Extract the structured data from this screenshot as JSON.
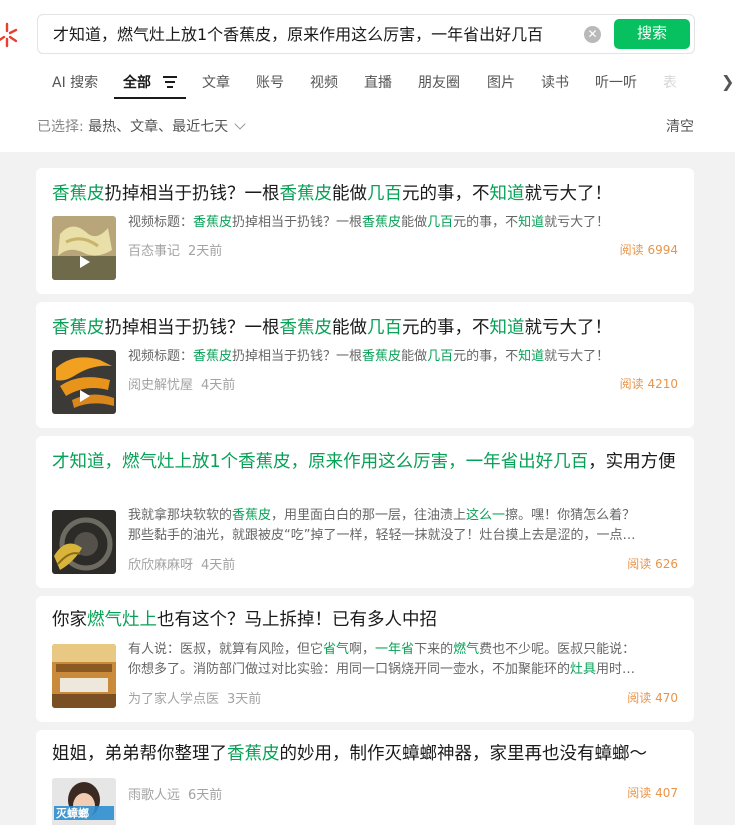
{
  "search": {
    "query": "才知道，燃气灶上放1个香蕉皮，原来作用这么厉害，一年省出好几百",
    "button_label": "搜索"
  },
  "tabs": [
    "AI 搜索",
    "全部",
    "文章",
    "账号",
    "视频",
    "直播",
    "朋友圈",
    "图片",
    "读书",
    "听一听",
    "表"
  ],
  "filters": {
    "prefix": "已选择:",
    "selected": "最热、文章、最近七天",
    "clear_label": "清空"
  },
  "results": [
    {
      "title": [
        [
          "香蕉皮",
          true
        ],
        [
          "扔掉相当于扔钱？一根",
          false
        ],
        [
          "香蕉皮",
          true
        ],
        [
          "能做",
          false
        ],
        [
          "几百",
          true
        ],
        [
          "元的事，不",
          false
        ],
        [
          "知道",
          true
        ],
        [
          "就亏大了！",
          false
        ]
      ],
      "snippet1": [
        [
          "视频标题：",
          false
        ],
        [
          "香蕉皮",
          true
        ],
        [
          "扔掉相当于扔钱？一根",
          false
        ],
        [
          "香蕉皮",
          true
        ],
        [
          "能做",
          false
        ],
        [
          "几百",
          true
        ],
        [
          "元的事，不",
          false
        ],
        [
          "知道",
          true
        ],
        [
          "就亏大了！",
          false
        ]
      ],
      "snippet2": [],
      "source": "百态事记",
      "time": "2天前",
      "reads": "阅读 6994",
      "video": true
    },
    {
      "title": [
        [
          "香蕉皮",
          true
        ],
        [
          "扔掉相当于扔钱？一根",
          false
        ],
        [
          "香蕉皮",
          true
        ],
        [
          "能做",
          false
        ],
        [
          "几百",
          true
        ],
        [
          "元的事，不",
          false
        ],
        [
          "知道",
          true
        ],
        [
          "就亏大了！",
          false
        ]
      ],
      "snippet1": [
        [
          "视频标题：",
          false
        ],
        [
          "香蕉皮",
          true
        ],
        [
          "扔掉相当于扔钱？一根",
          false
        ],
        [
          "香蕉皮",
          true
        ],
        [
          "能做",
          false
        ],
        [
          "几百",
          true
        ],
        [
          "元的事，不",
          false
        ],
        [
          "知道",
          true
        ],
        [
          "就亏大了！",
          false
        ]
      ],
      "snippet2": [],
      "source": "阅史解忧屋",
      "time": "4天前",
      "reads": "阅读 4210",
      "video": true
    },
    {
      "title": [
        [
          "才知道，燃气灶上放1个香蕉皮，原来作用这么厉害，一年省出好几百",
          true
        ],
        [
          "，实用方便",
          false
        ]
      ],
      "snippet1": [
        [
          "我就拿那块软软的",
          false
        ],
        [
          "香蕉皮",
          true
        ],
        [
          "，用里面白白的那一层，往油渍上",
          false
        ],
        [
          "这么一",
          true
        ],
        [
          "擦。嘿！你猜怎么着？",
          false
        ]
      ],
      "snippet2": [
        [
          "那些黏手的油光，就跟被皮“吃”掉了一样，轻轻一抹就没了！灶台摸上去是涩的，一点…",
          false
        ]
      ],
      "source": "欣欣麻麻呀",
      "time": "4天前",
      "reads": "阅读 626",
      "video": false
    },
    {
      "title": [
        [
          "你家",
          false
        ],
        [
          "燃气灶上",
          true
        ],
        [
          "也有这个？马上拆掉！已有多人中招",
          false
        ]
      ],
      "snippet1": [
        [
          "有人说：医叔，就算有风险，但它",
          false
        ],
        [
          "省气",
          true
        ],
        [
          "啊，",
          false
        ],
        [
          "一年省",
          true
        ],
        [
          "下来的",
          false
        ],
        [
          "燃气",
          true
        ],
        [
          "费也不少呢。医叔只能说：",
          false
        ]
      ],
      "snippet2": [
        [
          "你想多了。消防部门做过对比实验：用同一口锅烧开同一壶水，不加聚能环的",
          false
        ],
        [
          "灶具",
          true
        ],
        [
          "用时…",
          false
        ]
      ],
      "source": "为了家人学点医",
      "time": "3天前",
      "reads": "阅读 470",
      "video": false
    },
    {
      "title": [
        [
          "姐姐，弟弟帮你整理了",
          false
        ],
        [
          "香蕉皮",
          true
        ],
        [
          "的妙用，制作灭蟑螂神器，家里再也没有蟑螂～",
          false
        ]
      ],
      "snippet1": [],
      "snippet2": [],
      "source": "雨歌人远",
      "time": "6天前",
      "reads": "阅读 407",
      "video": false,
      "thumb_text": "灭蟑螂"
    }
  ]
}
